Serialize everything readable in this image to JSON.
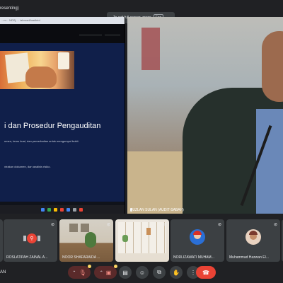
{
  "top": {
    "presenting_label": "resenting)",
    "fullscreen_hint": "To exit full screen, press",
    "fullscreen_key": "Esc"
  },
  "share": {
    "url": "...m... NDSj ... /abroad/loadkird",
    "slide_title": "i dan Prosedur Pengauditan",
    "slide_line1": "umen, temu bual, dan pemerhatian untuk mengumpul bukti.",
    "slide_line2": "xtrakan dokumen, dan analisis risiko."
  },
  "speaker": {
    "name": "SUZLAN SULAN (AUDIT-SABAH)"
  },
  "participants": [
    {
      "name": "",
      "mic_icon": "mic-off-icon"
    },
    {
      "name": "ROSLATIPAH ZAINAL A...",
      "mic_icon": "mic-off-icon"
    },
    {
      "name": "NOOR SHAFARAIDA ...",
      "mic_icon": "mic-off-icon"
    },
    {
      "name": "",
      "mic_icon": "mic-off-icon"
    },
    {
      "name": "NORLIZAWATI MUHAM...",
      "mic_icon": "mic-off-icon"
    },
    {
      "name": "Muhammad Hazwan El...",
      "mic_icon": "mic-off-icon"
    }
  ],
  "bottom": {
    "self_name": "AN"
  },
  "colors": {
    "hangup": "#ea4335",
    "slide_bg": "#101f4a"
  }
}
